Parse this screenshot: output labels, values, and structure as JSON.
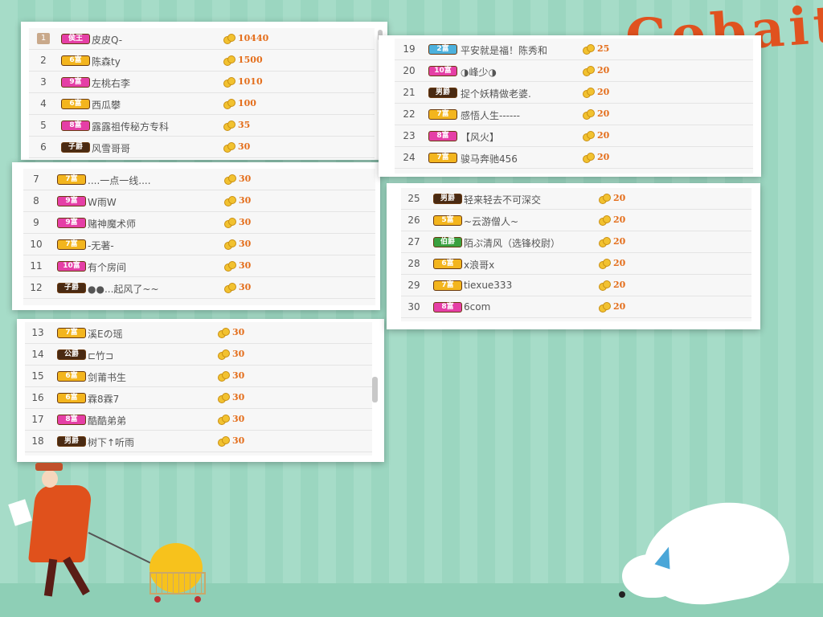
{
  "decor": {
    "title_fragment": "Cobait"
  },
  "colors": {
    "accent_score": "#e46f1d",
    "badge_gold": "#f3b51e",
    "badge_pink": "#e53fa6",
    "badge_dark": "#4a2a12",
    "badge_green": "#3aa13f",
    "badge_blue": "#4db1dd"
  },
  "panels": [
    {
      "rows": [
        {
          "rank": "1",
          "badge": "侯王",
          "badge_color": "pink",
          "name": "皮皮Q-",
          "score": "10440"
        },
        {
          "rank": "2",
          "badge": "6富",
          "badge_color": "gold",
          "name": "陈森ty",
          "score": "1500"
        },
        {
          "rank": "3",
          "badge": "9富",
          "badge_color": "pink",
          "name": "左桃右李",
          "score": "1010"
        },
        {
          "rank": "4",
          "badge": "6富",
          "badge_color": "gold",
          "name": "西瓜攀",
          "score": "100"
        },
        {
          "rank": "5",
          "badge": "8富",
          "badge_color": "pink",
          "name": "露露祖传秘方专科",
          "score": "35"
        },
        {
          "rank": "6",
          "badge": "子爵",
          "badge_color": "dark",
          "name": "风雪哥哥",
          "score": "30"
        }
      ]
    },
    {
      "rows": [
        {
          "rank": "7",
          "badge": "7富",
          "badge_color": "gold",
          "name": "....一点一线....",
          "score": "30"
        },
        {
          "rank": "8",
          "badge": "9富",
          "badge_color": "pink",
          "name": "W雨W",
          "score": "30"
        },
        {
          "rank": "9",
          "badge": "9富",
          "badge_color": "pink",
          "name": "赌神魔术师",
          "score": "30"
        },
        {
          "rank": "10",
          "badge": "7富",
          "badge_color": "gold",
          "name": "-无著-",
          "score": "30"
        },
        {
          "rank": "11",
          "badge": "10富",
          "badge_color": "pink",
          "name": "有个房间",
          "score": "30"
        },
        {
          "rank": "12",
          "badge": "子爵",
          "badge_color": "dark",
          "name": "●●...起风了~~",
          "score": "30"
        }
      ]
    },
    {
      "rows": [
        {
          "rank": "13",
          "badge": "7富",
          "badge_color": "gold",
          "name": "溪Eの瑶",
          "score": "30"
        },
        {
          "rank": "14",
          "badge": "公爵",
          "badge_color": "dark",
          "name": "⊏竹⊐",
          "score": "30"
        },
        {
          "rank": "15",
          "badge": "6富",
          "badge_color": "gold",
          "name": "剑莆书生",
          "score": "30"
        },
        {
          "rank": "16",
          "badge": "6富",
          "badge_color": "gold",
          "name": "霖8霖7",
          "score": "30"
        },
        {
          "rank": "17",
          "badge": "8富",
          "badge_color": "pink",
          "name": "酷酷弟弟",
          "score": "30"
        },
        {
          "rank": "18",
          "badge": "男爵",
          "badge_color": "dark",
          "name": "树下↑听雨",
          "score": "30"
        }
      ]
    },
    {
      "rows": [
        {
          "rank": "19",
          "badge": "2富",
          "badge_color": "blue",
          "name": "平安就是福！陈秀和",
          "score": "25"
        },
        {
          "rank": "20",
          "badge": "10富",
          "badge_color": "pink",
          "name": "◑峰少◑",
          "score": "20"
        },
        {
          "rank": "21",
          "badge": "男爵",
          "badge_color": "dark",
          "name": "捉个妖精做老婆.",
          "score": "20"
        },
        {
          "rank": "22",
          "badge": "7富",
          "badge_color": "gold",
          "name": "感悟人生------",
          "score": "20"
        },
        {
          "rank": "23",
          "badge": "8富",
          "badge_color": "pink",
          "name": "【风火】",
          "score": "20"
        },
        {
          "rank": "24",
          "badge": "7富",
          "badge_color": "gold",
          "name": "骏马奔驰456",
          "score": "20"
        }
      ]
    },
    {
      "rows": [
        {
          "rank": "25",
          "badge": "男爵",
          "badge_color": "dark",
          "name": "轻来轻去不可深交",
          "score": "20"
        },
        {
          "rank": "26",
          "badge": "5富",
          "badge_color": "gold",
          "name": "~云游僧人~",
          "score": "20"
        },
        {
          "rank": "27",
          "badge": "伯爵",
          "badge_color": "green",
          "name": "陌ぷ清风（选锋校尉）",
          "score": "20"
        },
        {
          "rank": "28",
          "badge": "6富",
          "badge_color": "gold",
          "name": "x浪哥x",
          "score": "20"
        },
        {
          "rank": "29",
          "badge": "7富",
          "badge_color": "gold",
          "name": "tiexue333",
          "score": "20"
        },
        {
          "rank": "30",
          "badge": "8富",
          "badge_color": "pink",
          "name": "6com",
          "score": "20"
        }
      ]
    }
  ]
}
